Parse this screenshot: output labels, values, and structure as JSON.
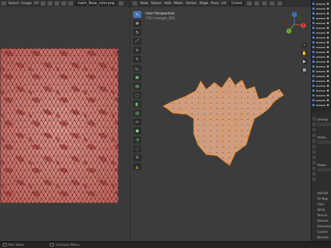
{
  "uv_editor": {
    "menus": [
      "Select",
      "Image",
      "UV"
    ],
    "image_name": "malin_Base_color.png",
    "view_label": "View"
  },
  "viewport": {
    "menus": [
      "View",
      "Select",
      "Add",
      "Mesh",
      "Vertex",
      "Edge",
      "Face",
      "UV"
    ],
    "transform_orientation": "Global",
    "info_title": "User Perspective",
    "info_object": "(76) triangle_001",
    "gizmo_axes": {
      "x": "X",
      "y": "Y",
      "z": "Z"
    },
    "axis_colors": {
      "x": "#e0473a",
      "y": "#7ab43a",
      "z": "#3b82d6"
    },
    "toolbar_icons": [
      "cursor-icon",
      "move-icon",
      "rotate-icon",
      "scale-icon",
      "transform-icon",
      "annotate-icon",
      "measure-icon",
      "add-cube-icon",
      "extrude-icon",
      "inset-icon",
      "bevel-icon",
      "loopcut-icon",
      "knife-icon",
      "polybuild-icon",
      "spin-icon",
      "smooth-icon",
      "shear-icon",
      "rip-icon"
    ]
  },
  "properties": {
    "header_label": "Options",
    "labels": [
      "Unwrap",
      "Vertex",
      "Shape",
      "Add Ref",
      "UV Map",
      "Color",
      "Attrib",
      "Texture",
      "Remesh",
      "Geometry",
      "Custom",
      "Normals"
    ]
  },
  "status_bar": {
    "left": "Pan View",
    "middle": "Context Menu"
  },
  "colors": {
    "mesh_orange": "#f08a24",
    "texture_base": "#d9766f",
    "texture_dark": "#a8403c",
    "accent_blue": "#4772b3"
  }
}
